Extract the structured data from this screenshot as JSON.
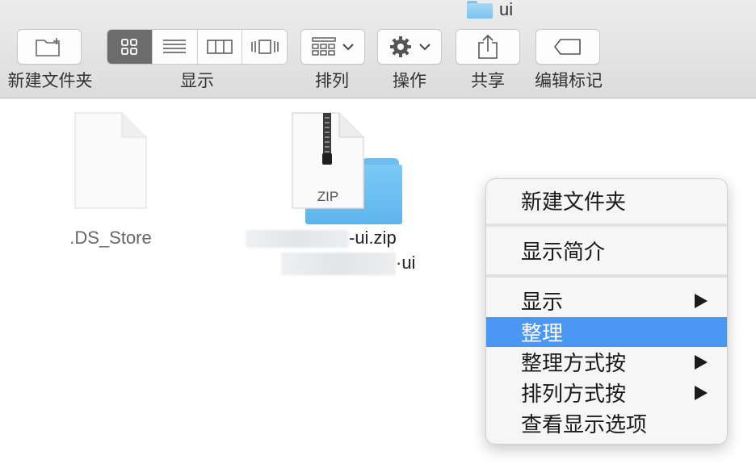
{
  "window": {
    "title": "ui"
  },
  "toolbar": {
    "new_folder": {
      "label": "新建文件夹",
      "icon": "new-folder-icon"
    },
    "view": {
      "label": "显示",
      "modes": [
        "icon-view",
        "list-view",
        "column-view",
        "cover-flow-view"
      ],
      "selected": "icon-view"
    },
    "arrange": {
      "label": "排列",
      "icon": "arrange-icon"
    },
    "action": {
      "label": "操作",
      "icon": "gear-icon"
    },
    "share": {
      "label": "共享",
      "icon": "share-icon"
    },
    "tags": {
      "label": "编辑标记",
      "icon": "tag-icon"
    }
  },
  "files": [
    {
      "name": ".DS_Store",
      "kind": "document"
    },
    {
      "name_suffix": "-ui.zip",
      "kind": "zip",
      "badge": "ZIP"
    },
    {
      "name_suffix": "·ui",
      "kind": "folder"
    }
  ],
  "context_menu": {
    "items": [
      {
        "label": "新建文件夹"
      },
      {
        "label": "显示简介"
      },
      {
        "label": "显示",
        "submenu": true
      },
      {
        "label": "整理",
        "highlighted": true
      },
      {
        "label": "整理方式按",
        "submenu": true
      },
      {
        "label": "排列方式按",
        "submenu": true
      },
      {
        "label": "查看显示选项"
      }
    ]
  },
  "colors": {
    "highlight": "#4a98f4",
    "folder": "#7cc2ee",
    "selected_segment": "#6c6c6c"
  }
}
